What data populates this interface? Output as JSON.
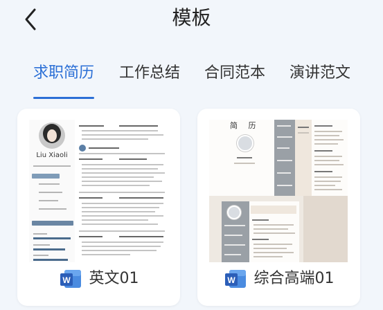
{
  "header": {
    "title": "模板",
    "back_icon": "chevron-left-icon"
  },
  "tabs": [
    {
      "label": "求职简历",
      "active": true
    },
    {
      "label": "工作总结",
      "active": false
    },
    {
      "label": "合同范本",
      "active": false
    },
    {
      "label": "演讲范文",
      "active": false
    }
  ],
  "colors": {
    "accent": "#2b6fd6",
    "background": "#f2f6fb",
    "word_blue": "#2b5eb8"
  },
  "cards": [
    {
      "label": "英文01",
      "icon": "word-icon",
      "thumb": {
        "name": "Liu Xiaoli",
        "objective": "Objective : Fitness Trainer",
        "section_personal": "personal",
        "section_skills": "SKILLS",
        "date1": "2014.09-2018.07",
        "section_professional": "Professional",
        "date2": "2017.07-2018.01",
        "company2": "Hubei Empire",
        "date3": "2018.09-2018.04",
        "company3": "PHYSICAL CLUB in Changsha",
        "date4": "2018.05-2018.12",
        "company4": "PHYSICAL CLUB in Changsha"
      }
    },
    {
      "label": "综合高端01",
      "icon": "word-icon",
      "thumb": {
        "title": "简 历",
        "name": "徐晓菲",
        "name2": "徐 晓 菲"
      }
    }
  ]
}
